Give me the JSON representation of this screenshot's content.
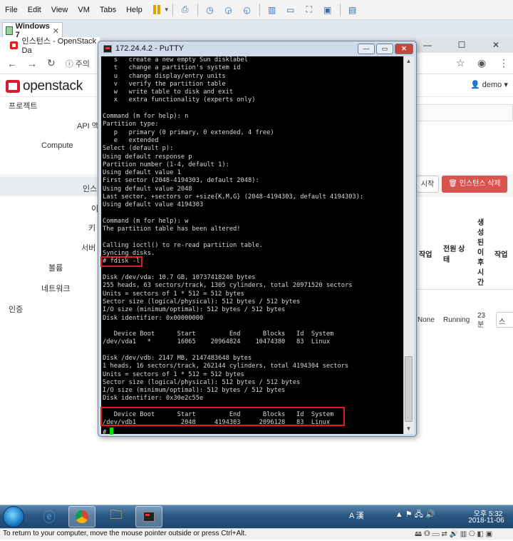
{
  "vmware": {
    "menu": [
      "File",
      "Edit",
      "View",
      "VM",
      "Tabs",
      "Help"
    ],
    "tab_label": "Windows 7",
    "status_text": "To return to your computer, move the mouse pointer outside or press Ctrl+Alt."
  },
  "browser": {
    "tab_title": "인스턴스 - OpenStack Da",
    "address_prefix": "주의 "
  },
  "openstack": {
    "brand": "openstack",
    "user": "demo",
    "nav": {
      "project": "프로젝트",
      "api": "API 액",
      "compute": "Compute",
      "instances": "인스",
      "images_abbr": "이",
      "keys_abbr": "키",
      "server_abbr": "서버",
      "volumes": "볼륨",
      "network": "네트워크",
      "identity": "인증"
    },
    "buttons": {
      "start": "시작",
      "delete": "인스턴스 삭제"
    },
    "table": {
      "headers": [
        "작업",
        "전원 상태",
        "생성된 이후 시간",
        "작업"
      ],
      "row": {
        "task": "None",
        "power": "Running",
        "age": "23 분",
        "action": "스냅"
      }
    }
  },
  "putty": {
    "title": "172.24.4.2 - PuTTY",
    "terminal_lines": [
      "   s   create a new empty Sun disklabel",
      "   t   change a partition's system id",
      "   u   change display/entry units",
      "   v   verify the partition table",
      "   w   write table to disk and exit",
      "   x   extra functionality (experts only)",
      "",
      "Command (m for help): n",
      "Partition type:",
      "   p   primary (0 primary, 0 extended, 4 free)",
      "   e   extended",
      "Select (default p):",
      "Using default response p",
      "Partition number (1-4, default 1):",
      "Using default value 1",
      "First sector (2048-4194303, default 2048):",
      "Using default value 2048",
      "Last sector, +sectors or +size{K,M,G} (2048-4194303, default 4194303):",
      "Using default value 4194303",
      "",
      "Command (m for help): w",
      "The partition table has been altered!",
      "",
      "Calling ioctl() to re-read partition table.",
      "Syncing disks.",
      "# fdisk -l",
      "",
      "Disk /dev/vda: 10.7 GB, 10737418240 bytes",
      "255 heads, 63 sectors/track, 1305 cylinders, total 20971520 sectors",
      "Units = sectors of 1 * 512 = 512 bytes",
      "Sector size (logical/physical): 512 bytes / 512 bytes",
      "I/O size (minimum/optimal): 512 bytes / 512 bytes",
      "Disk identifier: 0x00000000",
      "",
      "   Device Boot      Start         End      Blocks   Id  System",
      "/dev/vda1   *       16065    20964824    10474380   83  Linux",
      "",
      "Disk /dev/vdb: 2147 MB, 2147483648 bytes",
      "1 heads, 16 sectors/track, 262144 cylinders, total 4194304 sectors",
      "Units = sectors of 1 * 512 = 512 bytes",
      "Sector size (logical/physical): 512 bytes / 512 bytes",
      "I/O size (minimum/optimal): 512 bytes / 512 bytes",
      "Disk identifier: 0x30e2c55e",
      "",
      "   Device Boot      Start         End      Blocks   Id  System",
      "/dev/vdb1            2048     4194303     2096128   83  Linux",
      "# "
    ]
  },
  "taskbar": {
    "tray_ime": "A 漢",
    "time": "오후 5:32",
    "date": "2018-11-06"
  },
  "colors": {
    "terminal_bg": "#000000",
    "terminal_fg": "#d8d8d8",
    "cursor": "#00e000",
    "highlight": "#e21b1b",
    "delete_button": "#d9534f",
    "openstack_red": "#da1a32"
  },
  "icons": [
    "pause-icon",
    "snapshot-icon",
    "fullscreen-icon",
    "putty-icon",
    "start-orb-icon",
    "ie-icon",
    "chrome-icon",
    "folder-icon",
    "back-icon",
    "forward-icon",
    "reload-icon",
    "star-icon",
    "user-icon",
    "kebab-icon"
  ]
}
